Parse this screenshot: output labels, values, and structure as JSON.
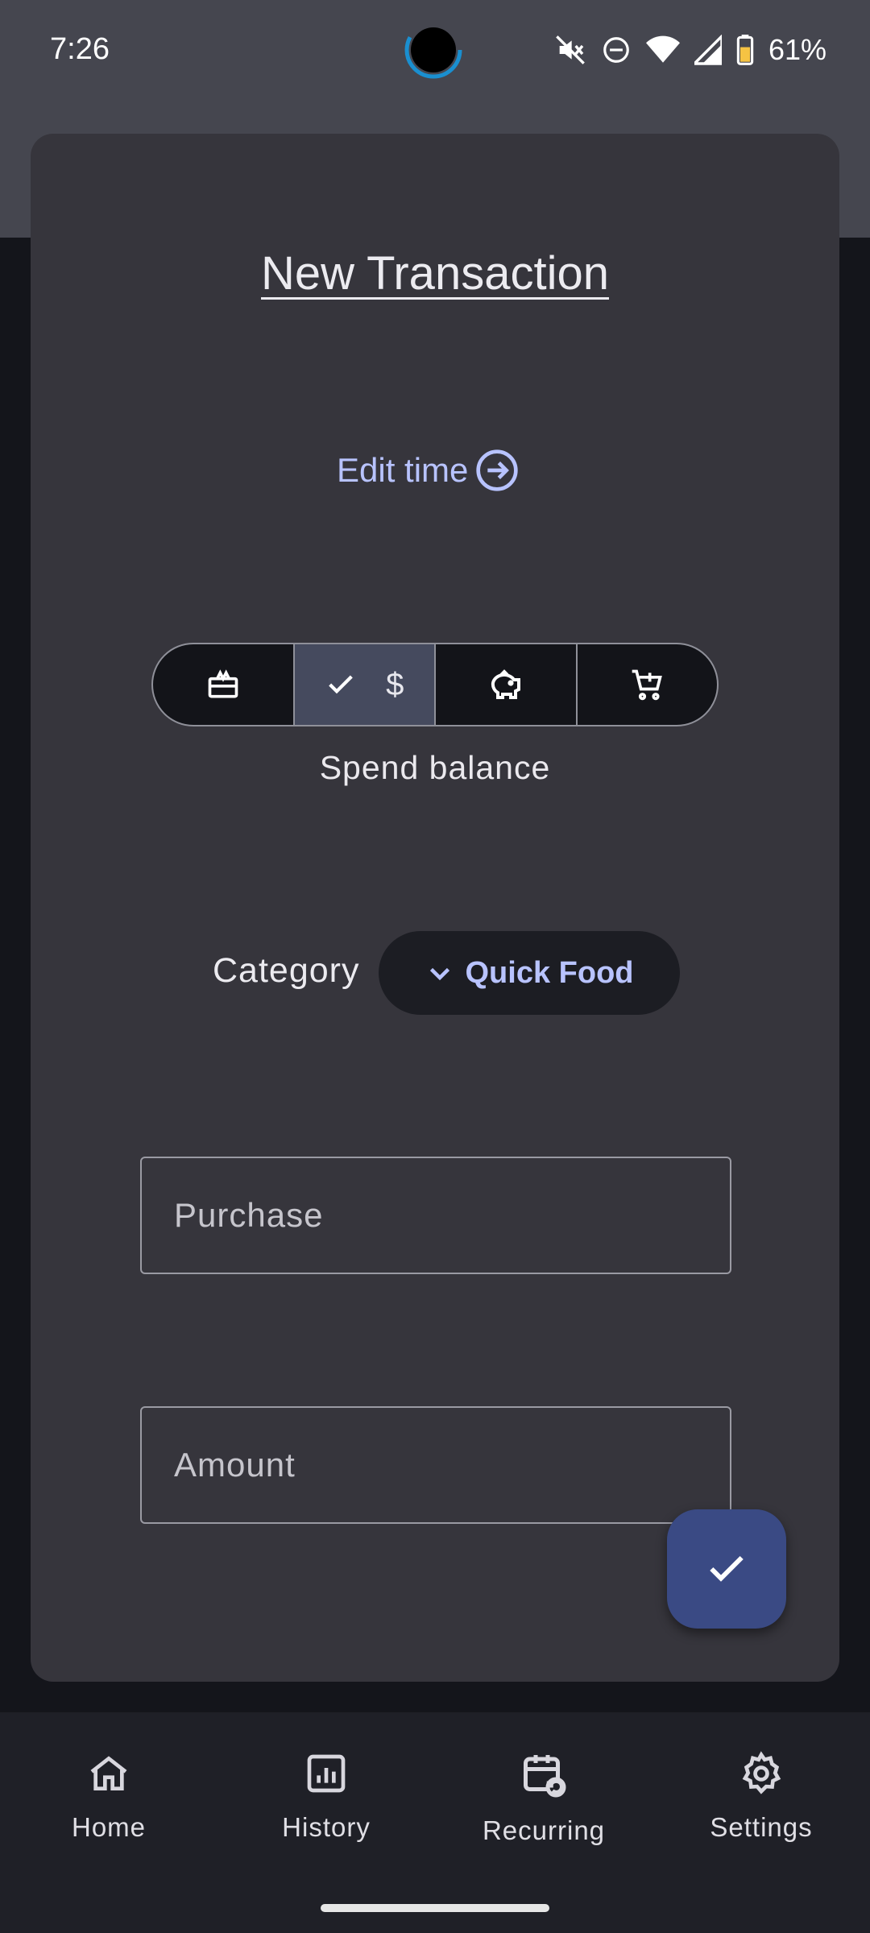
{
  "status_bar": {
    "time": "7:26",
    "battery": "61%",
    "icons": [
      "mute-icon",
      "dnd-icon",
      "wifi-icon",
      "signal-icon",
      "battery-icon"
    ]
  },
  "dialog": {
    "title": "New Transaction",
    "edit_time_label": "Edit time",
    "segments": [
      {
        "icon": "gift-card-icon",
        "selected": false
      },
      {
        "icon": "dollar-icon",
        "text": "$",
        "selected": true
      },
      {
        "icon": "piggy-bank-icon",
        "selected": false
      },
      {
        "icon": "cart-add-icon",
        "selected": false
      }
    ],
    "segment_label": "Spend balance",
    "category_label": "Category",
    "category_value": "Quick Food",
    "purchase_placeholder": "Purchase",
    "purchase_value": "",
    "amount_placeholder": "Amount",
    "amount_value": ""
  },
  "nav": {
    "items": [
      {
        "label": "Home",
        "icon": "home-icon"
      },
      {
        "label": "History",
        "icon": "history-chart-icon"
      },
      {
        "label": "Recurring",
        "icon": "recurring-calendar-icon"
      },
      {
        "label": "Settings",
        "icon": "gear-icon"
      }
    ]
  },
  "colors": {
    "accent": "#b8c3ff",
    "fab": "#3a4a84",
    "card": "#36353c",
    "selected_segment": "#454a5e"
  }
}
